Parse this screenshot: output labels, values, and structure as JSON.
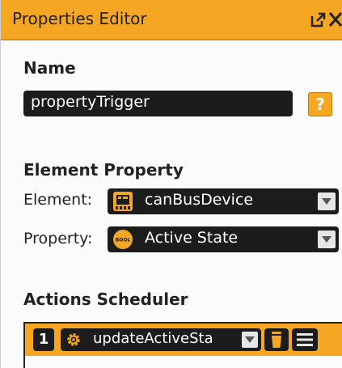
{
  "panel": {
    "title": "Properties Editor",
    "icons": [
      "popout-icon",
      "close-icon"
    ]
  },
  "name_section": {
    "heading": "Name",
    "value": "propertyTrigger",
    "help_label": "?"
  },
  "element_property": {
    "heading": "Element Property",
    "element_label": "Element:",
    "element_value": "canBusDevice",
    "element_icon": "device-icon",
    "property_label": "Property:",
    "property_value": "Active State",
    "property_icon": "bool-icon",
    "property_icon_text": "BOOL"
  },
  "actions": {
    "heading": "Actions Scheduler",
    "rows": [
      {
        "number": "1",
        "action": "updateActiveSta",
        "icon": "gear-icon"
      }
    ]
  },
  "colors": {
    "accent": "#f5a623",
    "field_bg": "#1c1c1c",
    "panel_bg": "#fbfbfb"
  }
}
